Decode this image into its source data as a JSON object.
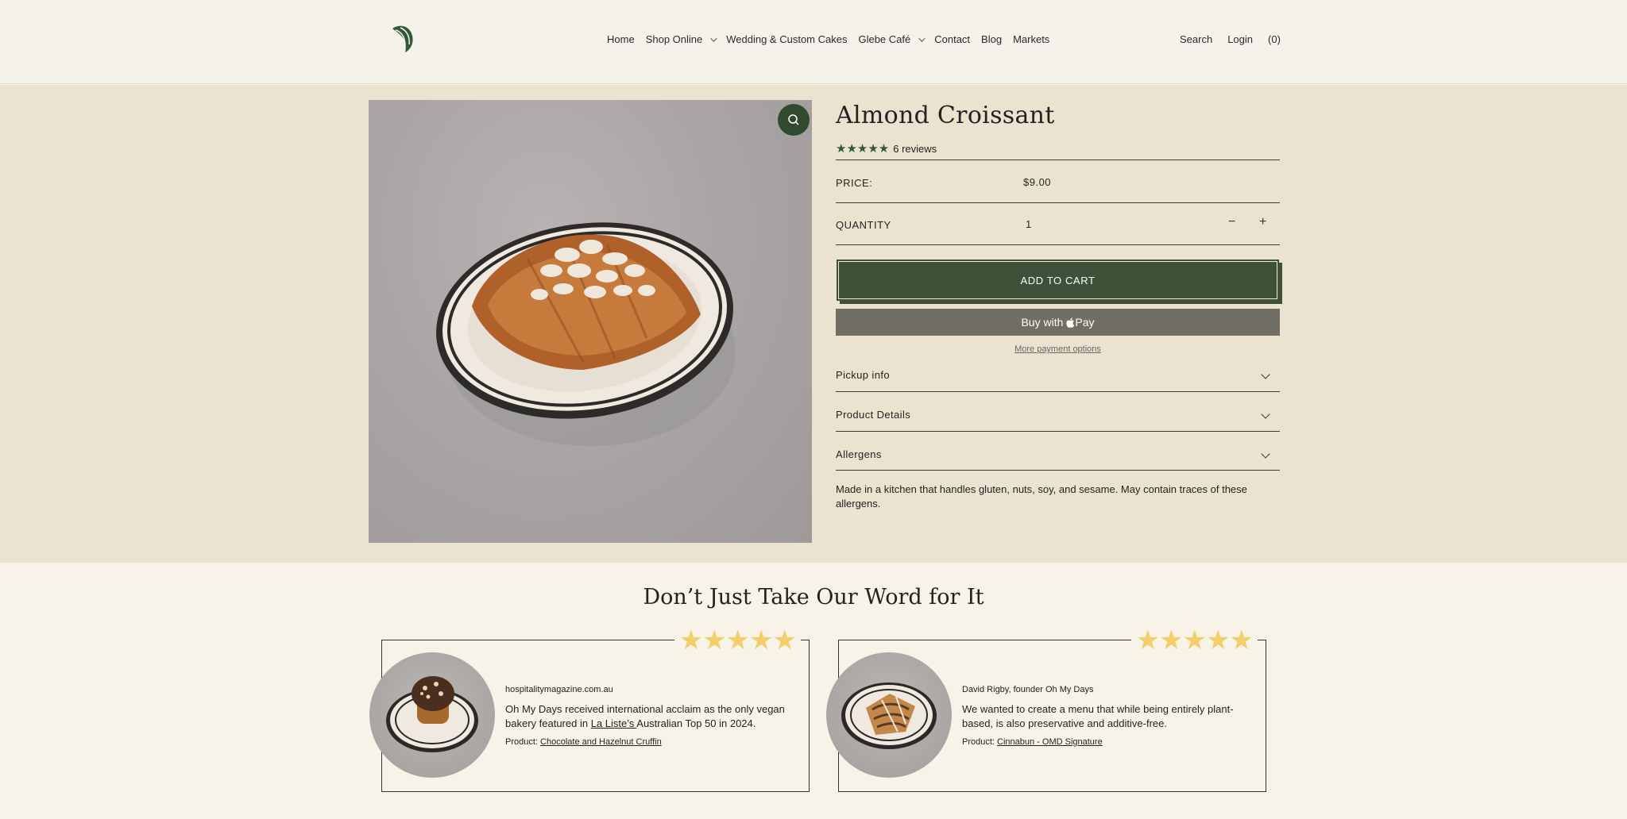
{
  "header": {
    "nav": [
      {
        "label": "Home",
        "dropdown": false
      },
      {
        "label": "Shop Online",
        "dropdown": true
      },
      {
        "label": "Wedding & Custom Cakes",
        "dropdown": false
      },
      {
        "label": "Glebe Café",
        "dropdown": true
      },
      {
        "label": "Contact",
        "dropdown": false
      },
      {
        "label": "Blog",
        "dropdown": false
      },
      {
        "label": "Markets",
        "dropdown": false
      }
    ],
    "search_label": "Search",
    "login_label": "Login",
    "cart_label": "(0)"
  },
  "product": {
    "title": "Almond Croissant",
    "stars": "★★★★★",
    "reviews": "6 reviews",
    "price_label": "PRICE:",
    "price": "$9.00",
    "quantity_label": "QUANTITY",
    "quantity": "1",
    "minus": "−",
    "plus": "+",
    "add_to_cart": "ADD TO CART",
    "buy_with": "Buy with",
    "pay": "Pay",
    "more_payment": "More payment options",
    "accordions": [
      "Pickup info",
      "Product Details",
      "Allergens"
    ],
    "allergen_text": "Made in a kitchen that handles gluten, nuts, soy, and sesame. May contain traces of these allergens."
  },
  "reviews": {
    "title": "Don’t Just Take Our Word for It",
    "cards": [
      {
        "stars": "★★★★★",
        "source": "hospitalitymagazine.com.au",
        "quote_pre": "Oh My Days received international acclaim as the only vegan bakery featured in ",
        "quote_link": "La Liste’s ",
        "quote_post": "Australian Top 50 in 2024.",
        "product_label": "Product: ",
        "product_link": "Chocolate and Hazelnut Cruffin"
      },
      {
        "stars": "★★★★★",
        "source": "David Rigby, founder Oh My Days",
        "quote_pre": "We wanted to create a menu that while being entirely plant-based, is also preservative and additive-free.",
        "quote_link": "",
        "quote_post": "",
        "product_label": "Product: ",
        "product_link": "Cinnabun - OMD Signature"
      }
    ]
  },
  "colors": {
    "brand_green": "#3f5239",
    "star_green": "#2e5a34",
    "star_gold": "#f3cf6a",
    "product_bg": "#ebe3d0",
    "page_bg": "#f7f3e9"
  }
}
